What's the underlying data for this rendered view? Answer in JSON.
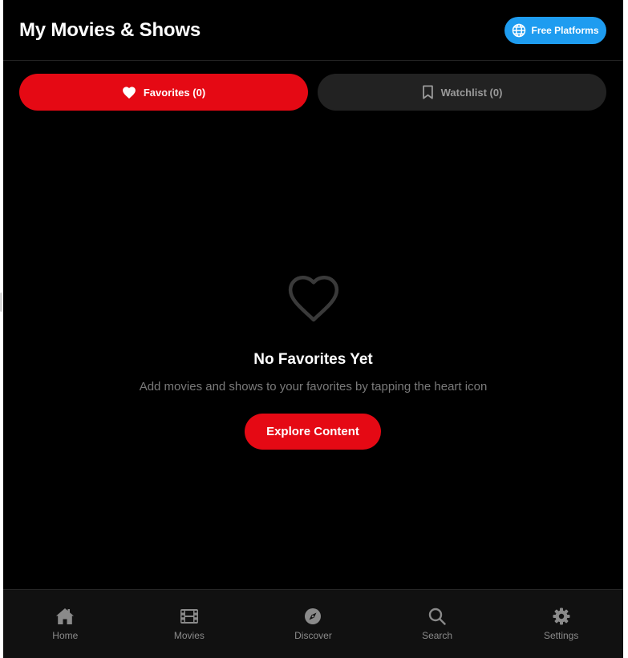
{
  "header": {
    "title": "My Movies & Shows",
    "platform_button": {
      "label": "Free Platforms",
      "icon": "globe-icon"
    }
  },
  "tabs": [
    {
      "label": "Favorites (0)",
      "icon": "heart-icon",
      "active": true
    },
    {
      "label": "Watchlist (0)",
      "icon": "bookmark-icon",
      "active": false
    }
  ],
  "empty_state": {
    "icon": "heart-outline-icon",
    "title": "No Favorites Yet",
    "subtitle": "Add movies and shows to your favorites by tapping the heart icon",
    "action_label": "Explore Content"
  },
  "bottom_nav": [
    {
      "label": "Home",
      "icon": "home-icon"
    },
    {
      "label": "Movies",
      "icon": "film-icon"
    },
    {
      "label": "Discover",
      "icon": "compass-icon"
    },
    {
      "label": "Search",
      "icon": "search-icon"
    },
    {
      "label": "Settings",
      "icon": "gear-icon"
    }
  ],
  "colors": {
    "background": "#000000",
    "accent": "#e50914",
    "platform_blue": "#1e9cf0",
    "inactive_tab": "#222222",
    "muted_text": "#7a7a7a",
    "nav_background": "#111111"
  }
}
